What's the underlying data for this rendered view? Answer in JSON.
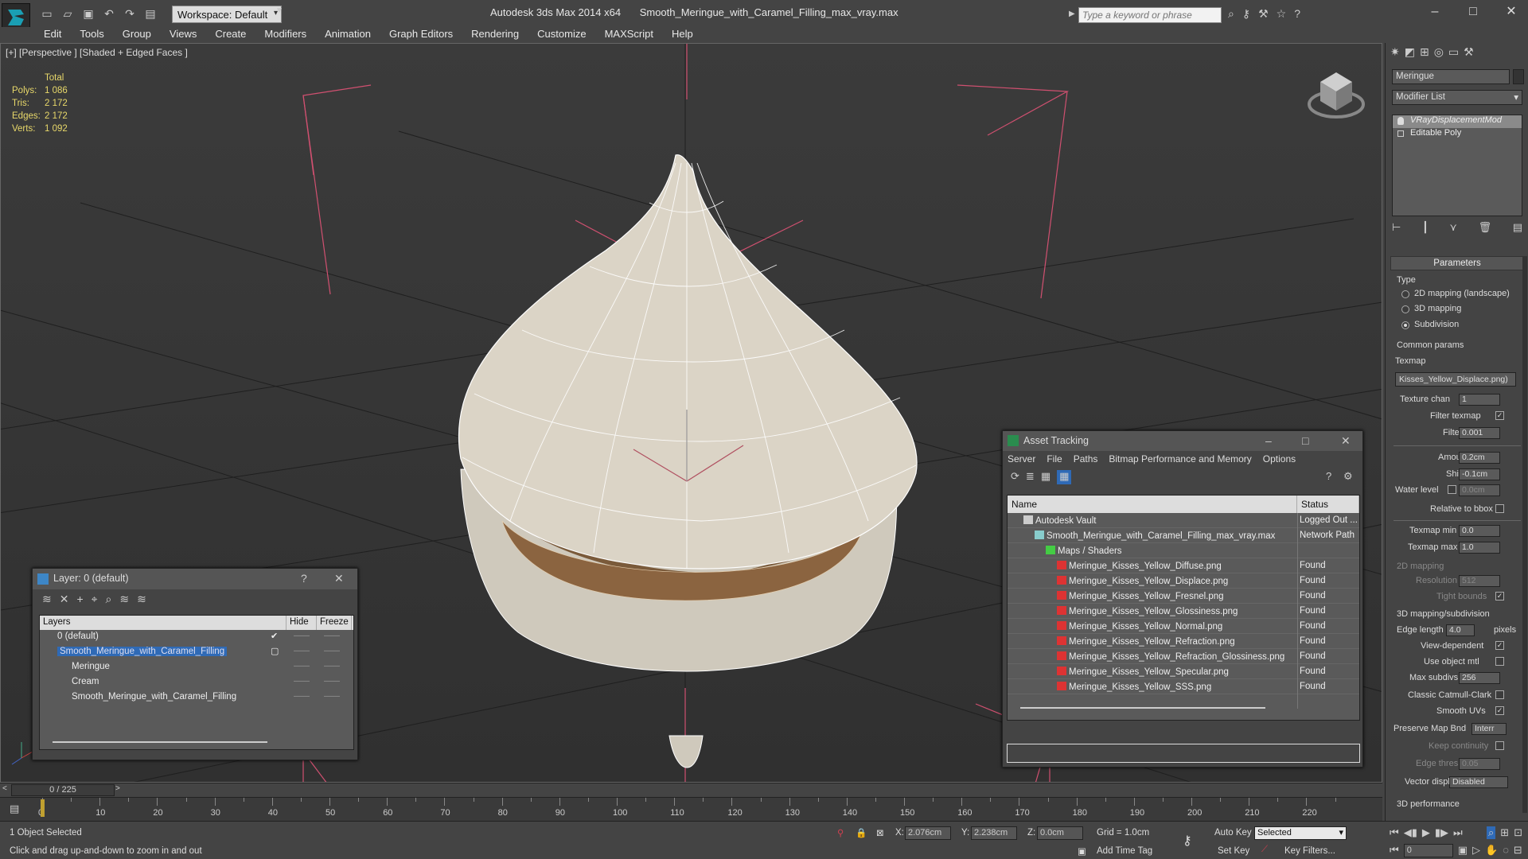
{
  "app": {
    "title_app": "Autodesk 3ds Max  2014 x64",
    "title_file": "Smooth_Meringue_with_Caramel_Filling_max_vray.max",
    "workspace": "Workspace: Default",
    "search_placeholder": "Type a keyword or phrase"
  },
  "menu": [
    "Edit",
    "Tools",
    "Group",
    "Views",
    "Create",
    "Modifiers",
    "Animation",
    "Graph Editors",
    "Rendering",
    "Customize",
    "MAXScript",
    "Help"
  ],
  "viewport": {
    "label": "[+] [Perspective ] [Shaded + Edged Faces ]",
    "stats_header": "Total",
    "stats": [
      {
        "k": "Polys:",
        "v": "1 086"
      },
      {
        "k": "Tris:",
        "v": "2 172"
      },
      {
        "k": "Edges:",
        "v": "2 172"
      },
      {
        "k": "Verts:",
        "v": "1 092"
      }
    ]
  },
  "layer_dialog": {
    "title": "Layer: 0 (default)",
    "help": "?",
    "col_layers": "Layers",
    "col_hide": "Hide",
    "col_freeze": "Freeze",
    "rows": [
      {
        "name": "0 (default)",
        "indent": 0,
        "selected": false,
        "check": "✔"
      },
      {
        "name": "Smooth_Meringue_with_Caramel_Filling",
        "indent": 0,
        "selected": true,
        "check": "▢"
      },
      {
        "name": "Meringue",
        "indent": 1,
        "selected": false,
        "check": ""
      },
      {
        "name": "Cream",
        "indent": 1,
        "selected": false,
        "check": ""
      },
      {
        "name": "Smooth_Meringue_with_Caramel_Filling",
        "indent": 1,
        "selected": false,
        "check": ""
      }
    ]
  },
  "asset_dialog": {
    "title": "Asset Tracking",
    "menu": [
      "Server",
      "File",
      "Paths",
      "Bitmap Performance and Memory",
      "Options"
    ],
    "col_name": "Name",
    "col_status": "Status",
    "rows": [
      {
        "name": "Autodesk Vault",
        "status": "Logged Out ...",
        "indent": 1,
        "icon": "vault"
      },
      {
        "name": "Smooth_Meringue_with_Caramel_Filling_max_vray.max",
        "status": "Network Path",
        "indent": 2,
        "icon": "max"
      },
      {
        "name": "Maps / Shaders",
        "status": "",
        "indent": 3,
        "icon": "maps"
      },
      {
        "name": "Meringue_Kisses_Yellow_Diffuse.png",
        "status": "Found",
        "indent": 4,
        "icon": "png"
      },
      {
        "name": "Meringue_Kisses_Yellow_Displace.png",
        "status": "Found",
        "indent": 4,
        "icon": "png"
      },
      {
        "name": "Meringue_Kisses_Yellow_Fresnel.png",
        "status": "Found",
        "indent": 4,
        "icon": "png"
      },
      {
        "name": "Meringue_Kisses_Yellow_Glossiness.png",
        "status": "Found",
        "indent": 4,
        "icon": "png"
      },
      {
        "name": "Meringue_Kisses_Yellow_Normal.png",
        "status": "Found",
        "indent": 4,
        "icon": "png"
      },
      {
        "name": "Meringue_Kisses_Yellow_Refraction.png",
        "status": "Found",
        "indent": 4,
        "icon": "png"
      },
      {
        "name": "Meringue_Kisses_Yellow_Refraction_Glossiness.png",
        "status": "Found",
        "indent": 4,
        "icon": "png"
      },
      {
        "name": "Meringue_Kisses_Yellow_Specular.png",
        "status": "Found",
        "indent": 4,
        "icon": "png"
      },
      {
        "name": "Meringue_Kisses_Yellow_SSS.png",
        "status": "Found",
        "indent": 4,
        "icon": "png"
      }
    ]
  },
  "command_panel": {
    "object_name": "Meringue",
    "modifier_list": "Modifier List",
    "stack": [
      "VRayDisplacementMod",
      "Editable Poly"
    ],
    "params_title": "Parameters",
    "type_label": "Type",
    "type_options": [
      "2D mapping (landscape)",
      "3D mapping",
      "Subdivision"
    ],
    "common_params": "Common params",
    "texmap_label": "Texmap",
    "texmap_value": "Kisses_Yellow_Displace.png)",
    "texture_chan_label": "Texture chan",
    "texture_chan": "1",
    "filter_texmap_label": "Filter texmap",
    "filter_blur_label": "Filter blur",
    "filter_blur": "0.001",
    "amount_label": "Amount",
    "amount": "0.2cm",
    "shift_label": "Shift",
    "shift": "-0.1cm",
    "water_level_label": "Water level",
    "water_level": "0.0cm",
    "relative_bbox_label": "Relative to bbox",
    "texmap_min_label": "Texmap min",
    "texmap_min": "0.0",
    "texmap_max_label": "Texmap max",
    "texmap_max": "1.0",
    "mapping2d": "2D mapping",
    "resolution_label": "Resolution",
    "resolution": "512",
    "tight_bounds_label": "Tight bounds",
    "mapping3d": "3D mapping/subdivision",
    "edge_length_label": "Edge length",
    "edge_length": "4.0",
    "pixels": "pixels",
    "view_dependent_label": "View-dependent",
    "use_object_mtl_label": "Use object mtl",
    "max_subdivs_label": "Max subdivs",
    "max_subdivs": "256",
    "classic_cc_label": "Classic Catmull-Clark",
    "smooth_uvs_label": "Smooth UVs",
    "preserve_map_label": "Preserve Map Bnd",
    "preserve_map": "Interr",
    "keep_continuity_label": "Keep continuity",
    "edge_thresh_label": "Edge thresh",
    "edge_thresh": "0.05",
    "vector_displ_label": "Vector displ",
    "vector_displ": "Disabled",
    "perf_3d": "3D performance"
  },
  "timeline": {
    "frame": "0 / 225",
    "labels": [
      "0",
      "10",
      "20",
      "30",
      "40",
      "50",
      "60",
      "70",
      "80",
      "90",
      "100",
      "110",
      "120",
      "130",
      "140",
      "150",
      "160",
      "170",
      "180",
      "190",
      "200",
      "210",
      "220"
    ]
  },
  "status": {
    "selection": "1 Object Selected",
    "prompt": "Click and drag up-and-down to zoom in and out",
    "x_label": "X:",
    "x": "2.076cm",
    "y_label": "Y:",
    "y": "2.238cm",
    "z_label": "Z:",
    "z": "0.0cm",
    "grid": "Grid = 1.0cm",
    "add_time_tag": "Add Time Tag",
    "auto_key": "Auto Key",
    "set_key": "Set Key",
    "selected": "Selected",
    "key_filters": "Key Filters...",
    "frame_field": "0"
  },
  "colors": {
    "accent_blue": "#2f6ab6",
    "stats_yellow": "#e8d86a",
    "bbox_pink": "#d05070"
  }
}
